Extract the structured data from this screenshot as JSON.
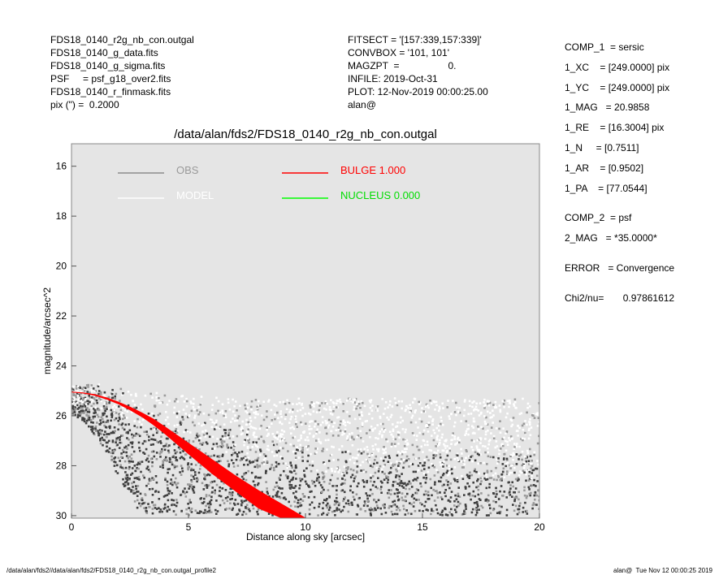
{
  "header_left": [
    "FDS18_0140_r2g_nb_con.outgal",
    "FDS18_0140_g_data.fits",
    "FDS18_0140_g_sigma.fits",
    "PSF     = psf_g18_over2.fits",
    "FDS18_0140_r_finmask.fits",
    "pix (\") =  0.2000"
  ],
  "header_mid": [
    "FITSECT = '[157:339,157:339]'",
    "CONVBOX = '101, 101'",
    "MAGZPT  =                  0.",
    "INFILE: 2019-Oct-31",
    "PLOT: 12-Nov-2019 00:00:25.00",
    "alan@"
  ],
  "info_right": [
    "COMP_1  = sersic",
    "1_XC    = [249.0000] pix",
    "1_YC    = [249.0000] pix",
    "1_MAG   = 20.9858",
    "1_RE    = [16.3004] pix",
    "1_N     = [0.7511]",
    "1_AR    = [0.9502]",
    "1_PA    = [77.0544]",
    "",
    "COMP_2  = psf",
    "2_MAG   = *35.0000*",
    "",
    "ERROR   = Convergence",
    "",
    "Chi2/nu=       0.97861612"
  ],
  "footer_left": "/data/alan/fds2//data/alan/fds2/FDS18_0140_r2g_nb_con.outgal_profile2",
  "footer_right": "alan@  Tue Nov 12 00:00:25 2019",
  "chart_data": {
    "type": "scatter",
    "title": "/data/alan/fds2/FDS18_0140_r2g_nb_con.outgal",
    "xlabel": "Distance along sky [arcsec]",
    "ylabel": "magnitude/arcsec^2",
    "xlim": [
      0,
      20
    ],
    "ylim": [
      30.1,
      15.1
    ],
    "y_inverted": true,
    "x_ticks": [
      0,
      5,
      10,
      15,
      20
    ],
    "y_ticks": [
      16,
      18,
      20,
      22,
      24,
      26,
      28,
      30
    ],
    "background": "#e5e5e5",
    "legend": [
      {
        "label": "OBS",
        "color": "#8c8c8c"
      },
      {
        "label": "MODEL",
        "color": "#ffffff"
      },
      {
        "label": "BULGE  1.000",
        "color": "#ff0000"
      },
      {
        "label": "NUCLEUS  0.000",
        "color": "#00ff00"
      }
    ],
    "series": [
      {
        "name": "OBS",
        "role": "observed pixels (white / grey / dark grey)",
        "colors": [
          "#ffffff",
          "#9a9a9a",
          "#404040"
        ],
        "x": [
          0.1,
          0.5,
          1.0,
          1.5,
          2.0,
          3.0,
          4.0,
          5.0,
          6.0,
          7.0,
          8.0,
          9.0,
          10.0,
          12.0,
          14.0,
          16.0,
          18.0,
          20.0
        ],
        "y_bright_edge": [
          24.8,
          24.8,
          24.7,
          24.8,
          24.9,
          25.0,
          25.1,
          25.2,
          25.2,
          25.3,
          25.3,
          25.3,
          25.3,
          25.3,
          25.3,
          25.3,
          25.3,
          25.3
        ],
        "y_center": [
          25.2,
          25.2,
          25.3,
          25.4,
          25.6,
          26.0,
          26.3,
          26.6,
          26.9,
          27.2,
          27.5,
          27.7,
          27.9,
          28.0,
          28.1,
          28.1,
          28.1,
          28.1
        ],
        "y_faint_edge": [
          26.0,
          26.2,
          26.8,
          27.5,
          28.5,
          30.0,
          30.0,
          30.0,
          30.0,
          30.0,
          30.0,
          30.0,
          30.0,
          30.0,
          30.0,
          30.0,
          30.0,
          30.0
        ]
      },
      {
        "name": "BULGE  1.000",
        "role": "model band (red)",
        "x": [
          0.0,
          0.5,
          1.0,
          1.5,
          2.0,
          2.5,
          3.0,
          3.5,
          4.0,
          5.0,
          6.0,
          7.0,
          8.0,
          9.0,
          10.0
        ],
        "y_lower": [
          25.05,
          25.08,
          25.15,
          25.28,
          25.45,
          25.65,
          25.88,
          26.13,
          26.45,
          27.1,
          27.75,
          28.4,
          29.0,
          29.55,
          30.1
        ],
        "y_upper": [
          25.05,
          25.09,
          25.18,
          25.33,
          25.52,
          25.76,
          26.03,
          26.35,
          26.72,
          27.52,
          28.3,
          29.0,
          29.7,
          30.1,
          30.1
        ]
      }
    ]
  }
}
